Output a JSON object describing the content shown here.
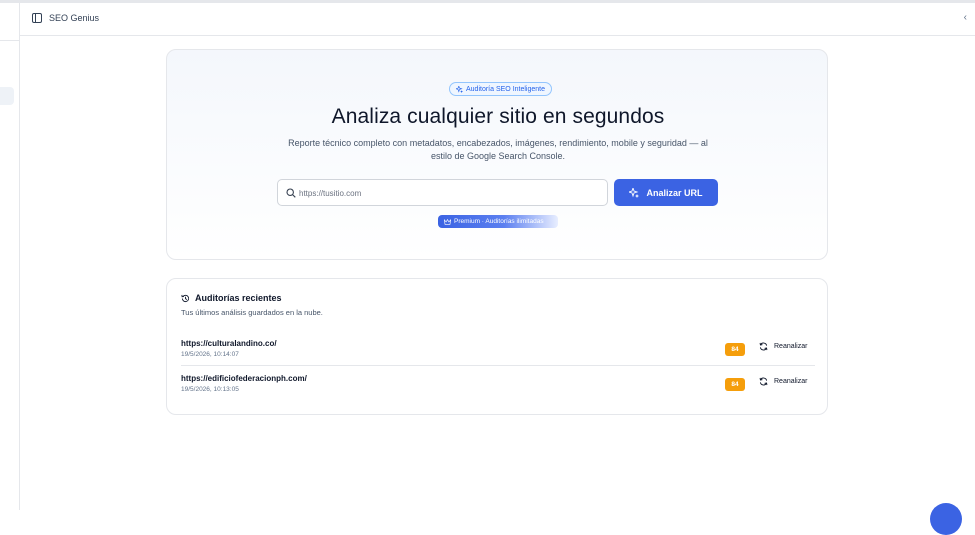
{
  "app": {
    "title": "SEO Genius"
  },
  "hero": {
    "badge": "Auditoría SEO Inteligente",
    "title": "Analiza cualquier sitio en segundos",
    "subtitle": "Reporte técnico completo con metadatos, encabezados, imágenes, rendimiento, mobile y seguridad — al estilo de Google Search Console.",
    "input_placeholder": "https://tusitio.com",
    "input_value": "",
    "button_label": "Analizar URL",
    "premium_label": "Premium · Auditorías ilimitadas"
  },
  "recent": {
    "title": "Auditorías recientes",
    "description": "Tus últimos análisis guardados en la nube.",
    "reanalyze_label": "Reanalizar",
    "items": [
      {
        "url": "https://culturalandino.co/",
        "date": "19/5/2026, 10:14:07",
        "score": "84"
      },
      {
        "url": "https://edificiofederacionph.com/",
        "date": "19/5/2026, 10:13:05",
        "score": "84"
      }
    ]
  },
  "colors": {
    "accent": "#3b63e3",
    "score": "#f59e0b",
    "badge_text": "#2563eb"
  },
  "icons": [
    "sidebar-toggle-icon",
    "sparkles-icon",
    "search-icon",
    "crown-icon",
    "history-icon",
    "refresh-icon",
    "chevron-left-icon"
  ]
}
